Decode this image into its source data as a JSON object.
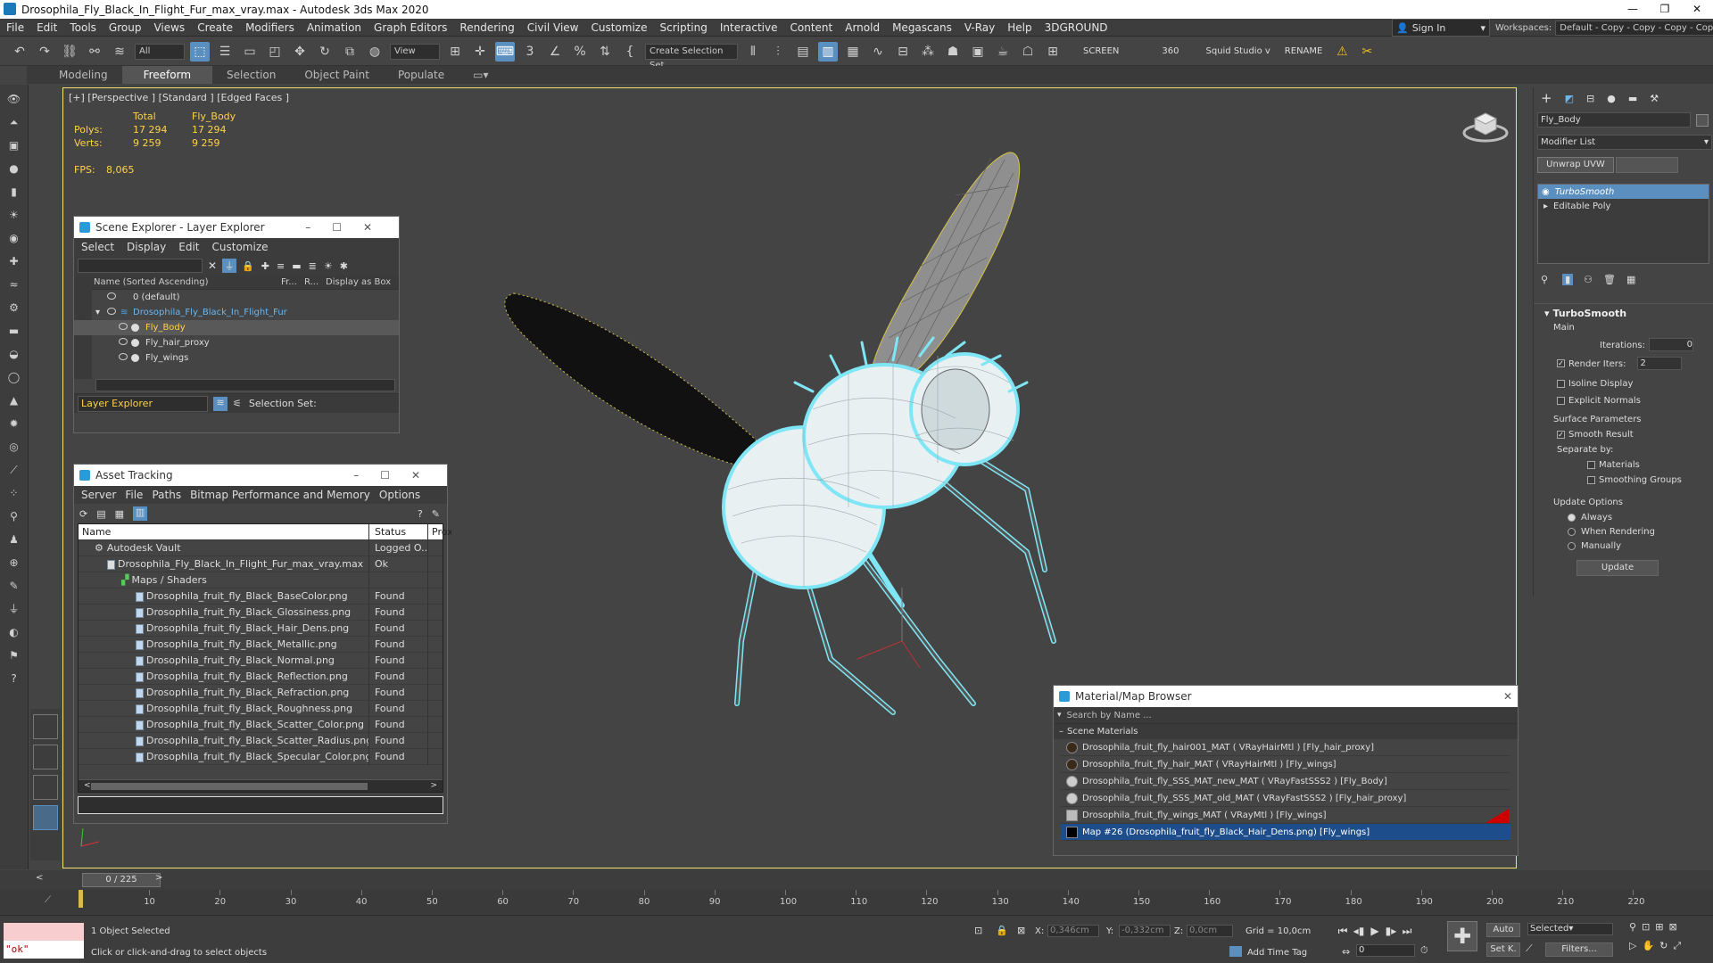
{
  "window": {
    "title": "Drosophila_Fly_Black_In_Flight_Fur_max_vray.max - Autodesk 3ds Max 2020",
    "minimize": "—",
    "maximize": "❐",
    "close": "✕"
  },
  "menu": [
    "File",
    "Edit",
    "Tools",
    "Group",
    "Views",
    "Create",
    "Modifiers",
    "Animation",
    "Graph Editors",
    "Rendering",
    "Civil View",
    "Customize",
    "Scripting",
    "Interactive",
    "Content",
    "Arnold",
    "Megascans",
    "V-Ray",
    "Help",
    "3DGROUND"
  ],
  "signin": {
    "label": "Sign In"
  },
  "workspaces": {
    "label": "Workspaces:",
    "value": "Default - Copy - Copy - Copy - Copy"
  },
  "toolbar": {
    "filter_value": "All",
    "view_value": "View",
    "selection_set_placeholder": "Create Selection Set",
    "screen_label": "SCREEN",
    "value_360": "360",
    "squid_label": "Squid Studio v",
    "rename_label": "RENAME"
  },
  "ribbon": {
    "tabs": [
      "Modeling",
      "Freeform",
      "Selection",
      "Object Paint",
      "Populate"
    ],
    "active": "Freeform"
  },
  "viewport": {
    "label": "[+] [Perspective ] [Standard ] [Edged Faces ]",
    "stats": {
      "col_total": "Total",
      "col_object": "Fly_Body",
      "polys_label": "Polys:",
      "polys_total": "17 294",
      "polys_object": "17 294",
      "verts_label": "Verts:",
      "verts_total": "9 259",
      "verts_object": "9 259",
      "fps_label": "FPS:",
      "fps_value": "8,065"
    }
  },
  "scene_explorer": {
    "title": "Scene Explorer - Layer Explorer",
    "menus": [
      "Select",
      "Display",
      "Edit",
      "Customize"
    ],
    "col_name": "Name (Sorted Ascending)",
    "col_fr": "Fr...",
    "col_r": "R...",
    "col_box": "Display as Box",
    "rows": [
      {
        "name": "0 (default)",
        "indent": 0
      },
      {
        "name": "Drosophila_Fly_Black_In_Flight_Fur",
        "indent": 0
      },
      {
        "name": "Fly_Body",
        "indent": 1
      },
      {
        "name": "Fly_hair_proxy",
        "indent": 1
      },
      {
        "name": "Fly_wings",
        "indent": 1
      }
    ],
    "layer_dropdown": "Layer Explorer",
    "selection_set_label": "Selection Set:"
  },
  "asset_tracking": {
    "title": "Asset Tracking",
    "menus": [
      "Server",
      "File",
      "Paths",
      "Bitmap Performance and Memory",
      "Options"
    ],
    "col_name": "Name",
    "col_status": "Status",
    "col_proxy": "Prox",
    "rows": [
      {
        "name": "Autodesk Vault",
        "status": "Logged O..."
      },
      {
        "name": "Drosophila_Fly_Black_In_Flight_Fur_max_vray.max",
        "status": "Ok"
      },
      {
        "name": "Maps / Shaders",
        "status": ""
      },
      {
        "name": "Drosophila_fruit_fly_Black_BaseColor.png",
        "status": "Found"
      },
      {
        "name": "Drosophila_fruit_fly_Black_Glossiness.png",
        "status": "Found"
      },
      {
        "name": "Drosophila_fruit_fly_Black_Hair_Dens.png",
        "status": "Found"
      },
      {
        "name": "Drosophila_fruit_fly_Black_Metallic.png",
        "status": "Found"
      },
      {
        "name": "Drosophila_fruit_fly_Black_Normal.png",
        "status": "Found"
      },
      {
        "name": "Drosophila_fruit_fly_Black_Reflection.png",
        "status": "Found"
      },
      {
        "name": "Drosophila_fruit_fly_Black_Refraction.png",
        "status": "Found"
      },
      {
        "name": "Drosophila_fruit_fly_Black_Roughness.png",
        "status": "Found"
      },
      {
        "name": "Drosophila_fruit_fly_Black_Scatter_Color.png",
        "status": "Found"
      },
      {
        "name": "Drosophila_fruit_fly_Black_Scatter_Radius.png",
        "status": "Found"
      },
      {
        "name": "Drosophila_fruit_fly_Black_Specular_Color.png",
        "status": "Found"
      }
    ]
  },
  "material_browser": {
    "title": "Material/Map Browser",
    "search_placeholder": "Search by Name ...",
    "section": "Scene Materials",
    "rows": [
      "Drosophila_fruit_fly_hair001_MAT  ( VRayHairMtl )  [Fly_hair_proxy]",
      "Drosophila_fruit_fly_hair_MAT  ( VRayHairMtl )  [Fly_wings]",
      "Drosophila_fruit_fly_SSS_MAT_new_MAT  ( VRayFastSSS2 )  [Fly_Body]",
      "Drosophila_fruit_fly_SSS_MAT_old_MAT  ( VRayFastSSS2 )  [Fly_hair_proxy]",
      "Drosophila_fruit_fly_wings_MAT  ( VRayMtl )  [Fly_wings]",
      "Map #26 (Drosophila_fruit_fly_Black_Hair_Dens.png)  [Fly_wings]"
    ]
  },
  "command_panel": {
    "object_name": "Fly_Body",
    "modifier_list": "Modifier List",
    "unwrap_button": "Unwrap UVW",
    "stack": [
      "TurboSmooth",
      "Editable Poly"
    ],
    "rollout_title": "TurboSmooth",
    "main_label": "Main",
    "iterations_label": "Iterations:",
    "iterations_value": "0",
    "render_iters_label": "Render Iters:",
    "render_iters_value": "2",
    "isoline_label": "Isoline Display",
    "explicit_label": "Explicit Normals",
    "surface_label": "Surface Parameters",
    "smooth_label": "Smooth Result",
    "separate_label": "Separate by:",
    "materials_label": "Materials",
    "smoothing_label": "Smoothing Groups",
    "update_options_label": "Update Options",
    "always_label": "Always",
    "when_rendering_label": "When Rendering",
    "manually_label": "Manually",
    "update_button": "Update"
  },
  "timeline": {
    "frame_display": "0 / 225",
    "ticks": [
      "0",
      "10",
      "20",
      "30",
      "40",
      "50",
      "60",
      "70",
      "80",
      "90",
      "100",
      "110",
      "120",
      "130",
      "140",
      "150",
      "160",
      "170",
      "180",
      "190",
      "200",
      "210",
      "220"
    ]
  },
  "status": {
    "maxscript_value": "\"ok\"",
    "selected_text": "1 Object Selected",
    "prompt_text": "Click or click-and-drag to select objects",
    "x_label": "X:",
    "x_value": "0,346cm",
    "y_label": "Y:",
    "y_value": "-0,332cm",
    "z_label": "Z:",
    "z_value": "0,0cm",
    "grid_text": "Grid = 10,0cm",
    "add_time_tag": "Add Time Tag",
    "auto_label": "Auto",
    "setk_label": "Set K.",
    "selected_dropdown": "Selected",
    "filters_label": "Filters...",
    "frame_value": "0"
  }
}
